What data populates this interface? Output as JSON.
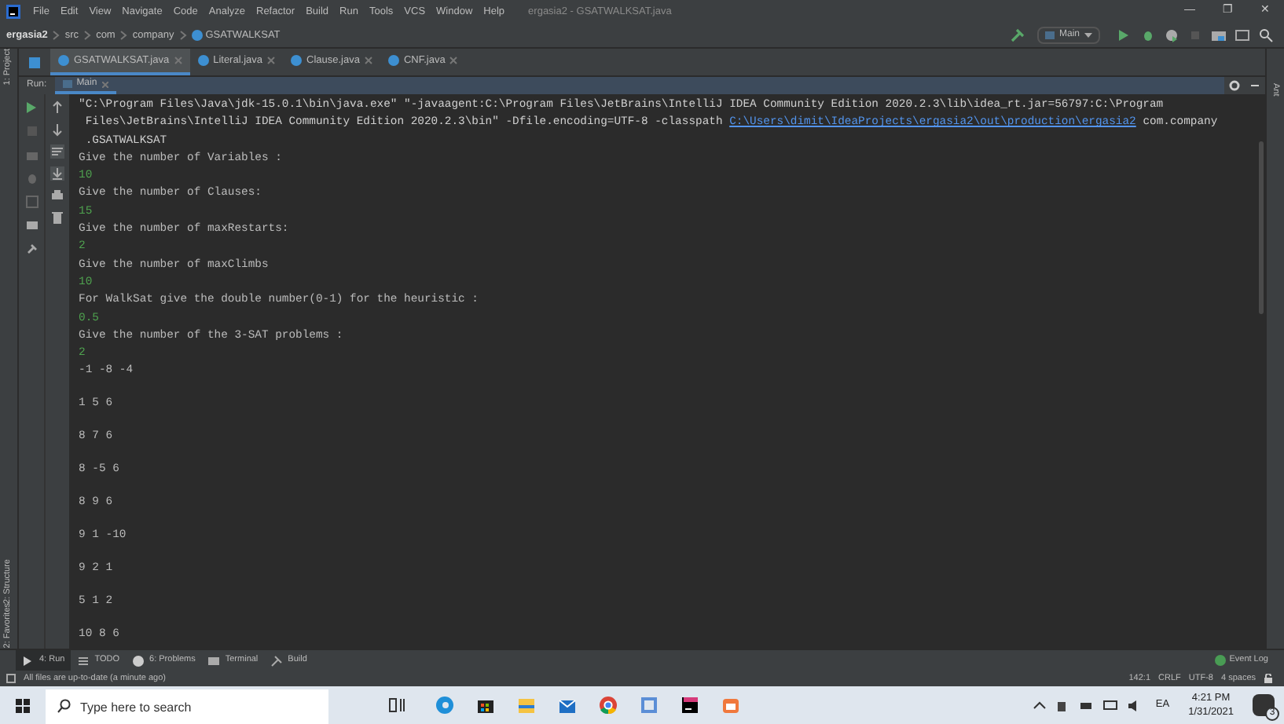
{
  "window": {
    "title": "ergasia2 - GSATWALKSAT.java",
    "controls": [
      "—",
      "❐",
      "✕"
    ]
  },
  "menu": [
    "File",
    "Edit",
    "View",
    "Navigate",
    "Code",
    "Analyze",
    "Refactor",
    "Build",
    "Run",
    "Tools",
    "VCS",
    "Window",
    "Help"
  ],
  "breadcrumb": [
    "ergasia2",
    "src",
    "com",
    "company",
    "GSATWALKSAT"
  ],
  "run_config": {
    "label": "Main"
  },
  "editor_tabs": [
    {
      "label": "GSATWALKSAT.java",
      "selected": true
    },
    {
      "label": "Literal.java",
      "selected": false
    },
    {
      "label": "Clause.java",
      "selected": false
    },
    {
      "label": "CNF.java",
      "selected": false
    }
  ],
  "left_strip": [
    "1: Project",
    "2: Structure",
    "2: Favorites"
  ],
  "right_strip": [
    "Ant"
  ],
  "run_panel": {
    "title": "Run:",
    "tabs": [
      {
        "label": "Main",
        "selected": true
      }
    ]
  },
  "console": [
    {
      "kind": "command",
      "parts": [
        {
          "kind": "text",
          "text": "\"C:\\Program Files\\Java\\jdk-15.0.1\\bin\\java.exe\" \"-javaagent:C:\\Program Files\\JetBrains\\IntelliJ IDEA Community Edition 2020.2.3\\lib\\idea_rt.jar=56797:C:\\Program"
        }
      ]
    },
    {
      "kind": "command",
      "parts": [
        {
          "kind": "text",
          "text": " Files\\JetBrains\\IntelliJ IDEA Community Edition 2020.2.3\\bin\" -Dfile.encoding=UTF-8 -classpath "
        },
        {
          "kind": "link",
          "text": "C:\\Users\\dimit\\IdeaProjects\\ergasia2\\out\\production\\ergasia2"
        },
        {
          "kind": "text",
          "text": " com.company"
        }
      ]
    },
    {
      "kind": "command",
      "parts": [
        {
          "kind": "text",
          "text": " .GSATWALKSAT"
        }
      ]
    },
    {
      "kind": "prompt",
      "text": "Give the number of Variables :"
    },
    {
      "kind": "input",
      "text": "10"
    },
    {
      "kind": "prompt",
      "text": "Give the number of Clauses:"
    },
    {
      "kind": "input",
      "text": "15"
    },
    {
      "kind": "prompt",
      "text": "Give the number of maxRestarts:"
    },
    {
      "kind": "input",
      "text": "2"
    },
    {
      "kind": "prompt",
      "text": "Give the number of maxClimbs"
    },
    {
      "kind": "input",
      "text": "10"
    },
    {
      "kind": "prompt",
      "text": "For WalkSat give the double number(0-1) for the heuristic :"
    },
    {
      "kind": "input",
      "text": "0.5"
    },
    {
      "kind": "prompt",
      "text": "Give the number of the 3-SAT problems :"
    },
    {
      "kind": "input",
      "text": "2"
    },
    {
      "kind": "data",
      "text": "-1 -8 -4"
    },
    {
      "kind": "data",
      "text": "1 5 6"
    },
    {
      "kind": "data",
      "text": "8 7 6"
    },
    {
      "kind": "data",
      "text": "8 -5 6"
    },
    {
      "kind": "data",
      "text": "8 9 6"
    },
    {
      "kind": "data",
      "text": "9 1 -10"
    },
    {
      "kind": "data",
      "text": "9 2 1"
    },
    {
      "kind": "data",
      "text": "5 1 2"
    },
    {
      "kind": "data",
      "text": "10 8 6"
    }
  ],
  "tool_tabs": [
    {
      "label": "4: Run",
      "selected": true
    },
    {
      "label": "TODO",
      "selected": false
    },
    {
      "label": "6: Problems",
      "selected": false
    },
    {
      "label": "Terminal",
      "selected": false
    },
    {
      "label": "Build",
      "selected": false
    }
  ],
  "event_log": "Event Log",
  "status_bar": {
    "message": "All files are up-to-date (a minute ago)",
    "items": [
      "142:1",
      "CRLF",
      "UTF-8",
      "4 spaces"
    ]
  },
  "taskbar": {
    "search_placeholder": "Type here to search",
    "language": "EA",
    "time": "4:21 PM",
    "date": "1/31/2021",
    "notifications": "3"
  }
}
